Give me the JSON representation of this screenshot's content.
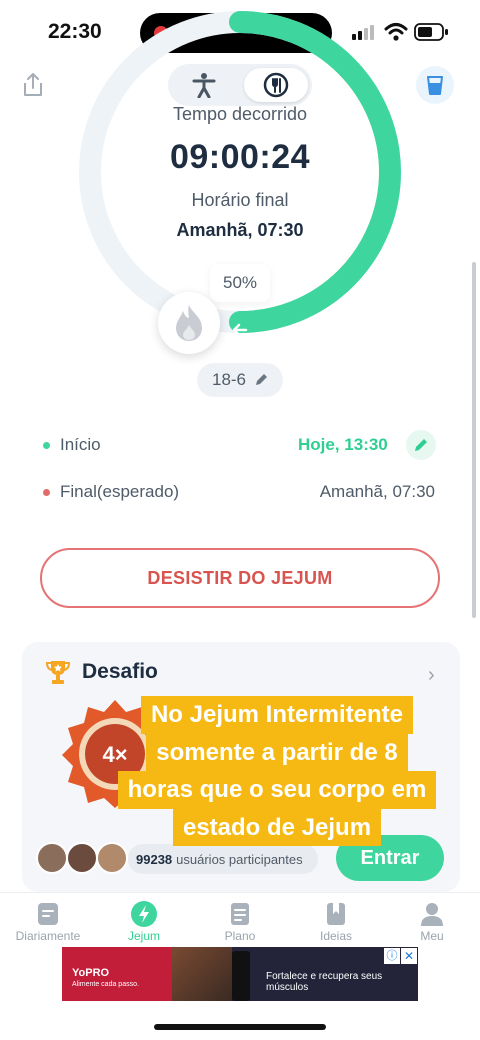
{
  "status_bar": {
    "time": "22:30"
  },
  "timer": {
    "elapsed_label": "Tempo decorrido",
    "elapsed_value": "09:00:24",
    "end_label": "Horário final",
    "end_value": "Amanhã, 07:30",
    "percent": "50%",
    "progress": 0.5,
    "plan": "18-6",
    "ring_color": "#3ed69e",
    "ring_track_color": "#eef3f7"
  },
  "schedule": {
    "start_label": "Início",
    "start_value": "Hoje, 13:30",
    "end_label": "Final(esperado)",
    "end_value": "Amanhã, 07:30"
  },
  "give_up_button": "DESISTIR DO JEJUM",
  "challenge": {
    "title": "Desafio",
    "badge_text": "4×",
    "participants_count": "99238",
    "participants_text": "usuários participantes",
    "join_button": "Entrar"
  },
  "caption": {
    "lines": [
      "No Jejum Intermitente",
      "somente a partir de 8",
      "horas que o seu corpo em",
      "estado de Jejum"
    ],
    "background_color": "#f6b913"
  },
  "tabs": [
    {
      "label": "Diariamente",
      "icon": "journal-icon"
    },
    {
      "label": "Jejum",
      "icon": "bolt-icon",
      "active": true
    },
    {
      "label": "Plano",
      "icon": "plan-icon"
    },
    {
      "label": "Ideias",
      "icon": "bookmark-icon"
    },
    {
      "label": "Meu",
      "icon": "profile-icon"
    }
  ],
  "ad": {
    "brand": "YoPRO",
    "tagline": "Alimente cada passo.",
    "text": "Fortalece e recupera seus músculos",
    "info": "ⓘ",
    "close": "✕"
  },
  "colors": {
    "accent": "#3ed69e",
    "danger": "#e57373",
    "title": "#1e2d40"
  }
}
